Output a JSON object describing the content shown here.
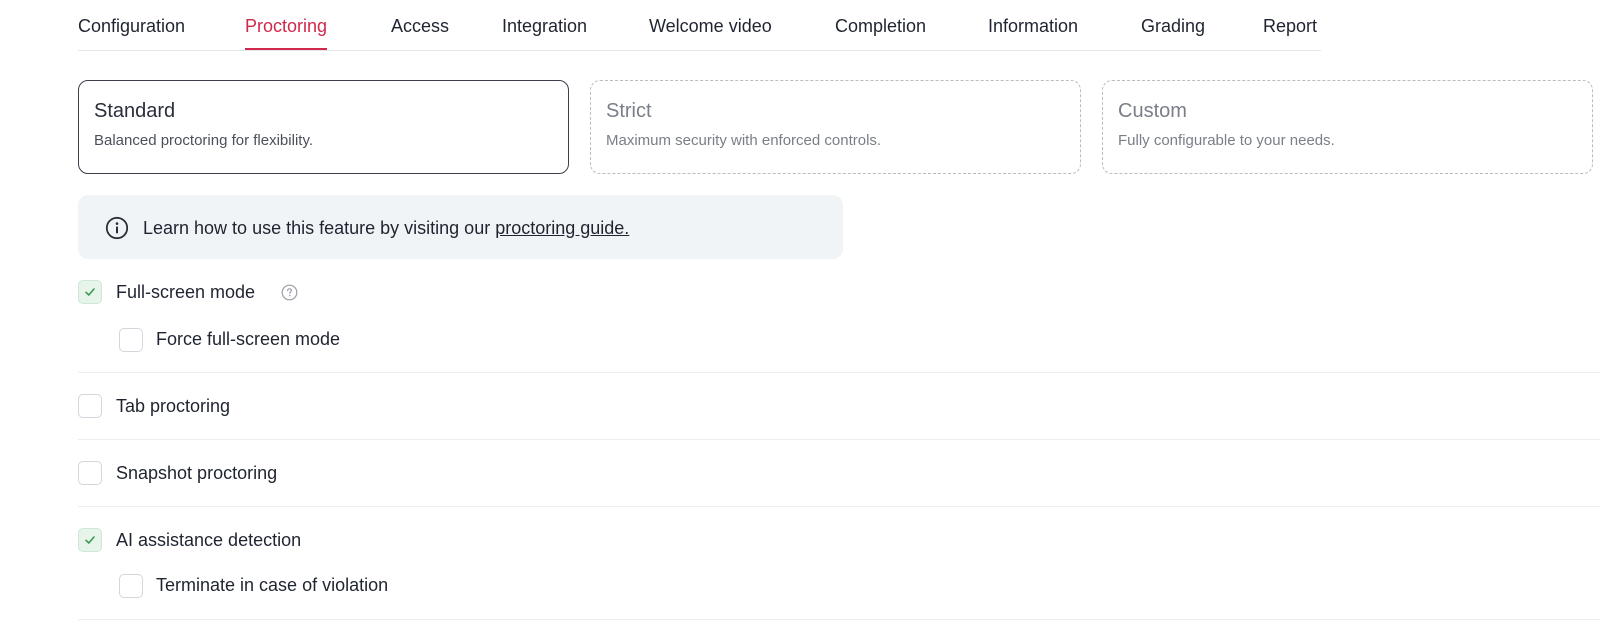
{
  "tabs": [
    {
      "label": "Configuration"
    },
    {
      "label": "Proctoring"
    },
    {
      "label": "Access"
    },
    {
      "label": "Integration"
    },
    {
      "label": "Welcome video"
    },
    {
      "label": "Completion"
    },
    {
      "label": "Information"
    },
    {
      "label": "Grading"
    },
    {
      "label": "Report"
    }
  ],
  "active_tab": "Proctoring",
  "modes": [
    {
      "title": "Standard",
      "description": "Balanced proctoring for flexibility.",
      "selected": true
    },
    {
      "title": "Strict",
      "description": "Maximum security with enforced controls.",
      "selected": false
    },
    {
      "title": "Custom",
      "description": "Fully configurable to your needs.",
      "selected": false
    }
  ],
  "info": {
    "icon": "info-icon",
    "text": "Learn how to use this feature by visiting our",
    "link_text": "proctoring guide."
  },
  "options": {
    "full_screen": {
      "label": "Full-screen mode",
      "checked": true,
      "help_icon": "question-circle-icon"
    },
    "force_full_screen": {
      "label": "Force full-screen mode",
      "checked": false
    },
    "tab_proctoring": {
      "label": "Tab proctoring",
      "checked": false
    },
    "snapshot_proctoring": {
      "label": "Snapshot proctoring",
      "checked": false
    },
    "ai_detection": {
      "label": "AI assistance detection",
      "checked": true
    },
    "terminate_on_violation": {
      "label": "Terminate in case of violation",
      "checked": false
    }
  },
  "colors": {
    "accent": "#d0284b",
    "check_bg": "#e7f4ea",
    "check_mark": "#3a9a55",
    "banner_bg": "#f1f4f7"
  }
}
